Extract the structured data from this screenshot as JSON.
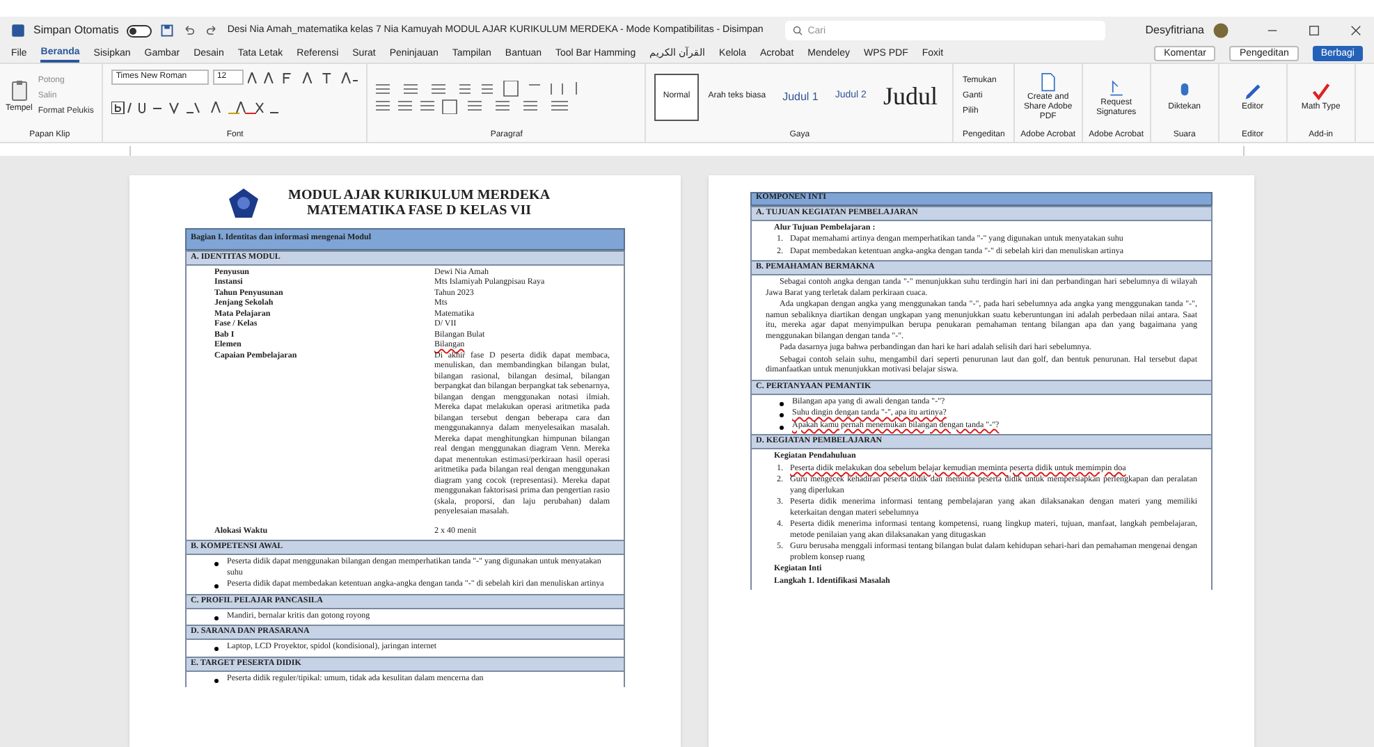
{
  "titlebar": {
    "autosave_label": "Simpan Otomatis",
    "autosave_on": false,
    "filename": "Desi Nia Amah_matematika kelas 7 Nia Kamuyah MODUL AJAR KURIKULUM MERDEKA - Mode Kompatibilitas - Disimpan",
    "search_placeholder": "Cari",
    "user": "Desyfitriana"
  },
  "menu_tabs": [
    {
      "label": "File",
      "selected": false
    },
    {
      "label": "Beranda",
      "selected": true
    },
    {
      "label": "Sisipkan",
      "selected": false
    },
    {
      "label": "Gambar",
      "selected": false
    },
    {
      "label": "Desain",
      "selected": false
    },
    {
      "label": "Tata Letak",
      "selected": false
    },
    {
      "label": "Referensi",
      "selected": false
    },
    {
      "label": "Surat",
      "selected": false
    },
    {
      "label": "Peninjauan",
      "selected": false
    },
    {
      "label": "Tampilan",
      "selected": false
    },
    {
      "label": "Bantuan",
      "selected": false
    },
    {
      "label": "Tool Bar Hamming",
      "selected": false
    },
    {
      "label": "القرآن الكريم",
      "selected": false
    },
    {
      "label": "Kelola",
      "selected": false
    },
    {
      "label": "Acrobat",
      "selected": false
    },
    {
      "label": "Mendeley",
      "selected": false
    },
    {
      "label": "WPS PDF",
      "selected": false
    },
    {
      "label": "Foxit",
      "selected": false
    }
  ],
  "action_buttons": [
    {
      "label": "Komentar",
      "kind": "plain"
    },
    {
      "label": "Pengeditan",
      "kind": "plain"
    },
    {
      "label": "Berbagi",
      "kind": "primary"
    }
  ],
  "clipboard": {
    "paste": "Tempel",
    "cut": "Potong",
    "copy": "Salin",
    "painter": "Format Pelukis",
    "label": "Papan Klip"
  },
  "font": {
    "name": "Times New Roman",
    "size": "12",
    "label": "Font"
  },
  "paragraph": {
    "label": "Paragraf"
  },
  "styles": {
    "label": "Gaya",
    "items": [
      {
        "label": "Normal",
        "kind": "normal",
        "selected": true
      },
      {
        "label": "Arah teks biasa",
        "kind": "normal",
        "selected": false
      },
      {
        "label": "Judul 1",
        "kind": "heading1",
        "selected": false
      },
      {
        "label": "Judul 2",
        "kind": "heading2",
        "selected": false
      },
      {
        "label": "Judul",
        "kind": "title",
        "selected": false
      }
    ]
  },
  "editing": {
    "label": "Pengeditan",
    "items": [
      "Temukan",
      "Ganti",
      "Pilih"
    ]
  },
  "addins": [
    {
      "label": "Create and Share Adobe PDF",
      "group": "Adobe Acrobat",
      "kind": "pdf"
    },
    {
      "label": "Request Signatures",
      "group": "Adobe Acrobat",
      "kind": "sign"
    },
    {
      "label": "Diktekan",
      "group": "Suara",
      "kind": "mic"
    },
    {
      "label": "Editor",
      "group": "Editor",
      "kind": "pen"
    },
    {
      "label": "Math Type",
      "group": "Add-in",
      "kind": "check"
    }
  ],
  "page_left": {
    "title_lines": [
      "MODUL AJAR KURIKULUM MERDEKA",
      "MATEMATIKA FASE D KELAS VII"
    ],
    "banner": "Bagian I. Identitas dan informasi mengenai Modul",
    "sections": [
      {
        "heading": "A. IDENTITAS MODUL",
        "blocks": [
          {
            "kind": "fields",
            "rows": [
              {
                "label": "Penyusun",
                "value": "Dewi Nia Amah",
                "flagged": false
              },
              {
                "label": "Instansi",
                "value": "Mts Islamiyah Pulangpisau Raya",
                "flagged": false
              },
              {
                "label": "Tahun Penyusunan",
                "value": "Tahun 2023",
                "flagged": false
              },
              {
                "label": "Jenjang Sekolah",
                "value": "Mts",
                "flagged": false
              },
              {
                "label": "Mata Pelajaran",
                "value": "Matematika",
                "flagged": false
              },
              {
                "label": "Fase / Kelas",
                "value": "D/ VII",
                "flagged": false
              },
              {
                "label": "Bab I",
                "value": "Bilangan Bulat",
                "flagged": false
              },
              {
                "label": "Elemen",
                "value": "Bilangan",
                "flagged": true
              },
              {
                "label": "Capaian Pembelajaran",
                "value": "Di akhir fase D peserta didik dapat membaca, menuliskan, dan membandingkan bilangan bulat, bilangan rasional, bilangan desimal, bilangan berpangkat dan bilangan berpangkat tak sebenarnya, bilangan dengan menggunakan notasi ilmiah. Mereka dapat melakukan operasi aritmetika pada bilangan tersebut dengan beberapa cara dan menggunakannya dalam menyelesaikan masalah. Mereka dapat menghitungkan himpunan bilangan real dengan menggunakan diagram Venn. Mereka dapat menentukan estimasi/perkiraan hasil operasi aritmetika pada bilangan real dengan menggunakan diagram yang cocok (representasi). Mereka dapat menggunakan faktorisasi prima dan pengertian rasio (skala, proporsi, dan laju perubahan) dalam penyelesaian masalah.",
                "flagged": false
              },
              {
                "label": "Alokasi Waktu",
                "value": "2 x 40 menit",
                "flagged": false
              }
            ]
          }
        ]
      },
      {
        "heading": "B. KOMPETENSI AWAL",
        "blocks": [
          {
            "kind": "bullets",
            "items": [
              {
                "text": "Peserta didik dapat menggunakan bilangan dengan memperhatikan tanda \"-\" yang digunakan untuk menyatakan suhu",
                "flagged": false
              },
              {
                "text": "Peserta didik dapat membedakan ketentuan angka-angka dengan tanda \"-\" di sebelah kiri dan menuliskan artinya",
                "flagged": false
              }
            ]
          }
        ]
      },
      {
        "heading": "C. PROFIL PELAJAR PANCASILA",
        "blocks": [
          {
            "kind": "bullets",
            "items": [
              {
                "text": "Mandiri, bernalar kritis dan gotong royong",
                "flagged": false
              }
            ]
          }
        ]
      },
      {
        "heading": "D. SARANA DAN PRASARANA",
        "blocks": [
          {
            "kind": "bullets",
            "items": [
              {
                "text": "Laptop, LCD Proyektor, spidol (kondisional), jaringan internet",
                "flagged": false
              }
            ]
          }
        ]
      },
      {
        "heading": "E. TARGET PESERTA DIDIK",
        "blocks": [
          {
            "kind": "bullets",
            "items": [
              {
                "text": "Peserta didik reguler/tipikal: umum, tidak ada kesulitan dalam mencerna dan",
                "flagged": false
              }
            ]
          }
        ]
      }
    ]
  },
  "page_right": {
    "banner": "KOMPONEN INTI",
    "sections": [
      {
        "heading": "A. TUJUAN KEGIATAN PEMBELAJARAN",
        "blocks": [
          {
            "kind": "subheading",
            "text": "Alur Tujuan Pembelajaran :"
          },
          {
            "kind": "numbered",
            "items": [
              {
                "number": "1.",
                "text": "Dapat memahami artinya dengan memperhatikan tanda \"-\" yang digunakan untuk menyatakan suhu",
                "flagged": false
              },
              {
                "number": "2.",
                "text": "Dapat membedakan ketentuan angka-angka dengan tanda \"-\" di sebelah kiri dan menuliskan artinya",
                "flagged": false
              }
            ]
          }
        ]
      },
      {
        "heading": "B. PEMAHAMAN BERMAKNA",
        "blocks": [
          {
            "kind": "paragraph",
            "text": "Sebagai contoh angka dengan tanda \"-\" menunjukkan suhu terdingin hari ini dan perbandingan hari sebelumnya di wilayah Jawa Barat yang terletak dalam perkiraan cuaca."
          },
          {
            "kind": "paragraph",
            "text": "Ada ungkapan dengan angka yang menggunakan tanda \"-\", pada hari sebelumnya ada angka yang menggunakan tanda \"-\", namun sebaliknya diartikan dengan ungkapan yang menunjukkan suatu keberuntungan ini adalah perbedaan nilai antara. Saat itu, mereka agar dapat menyimpulkan berupa penukaran pemahaman tentang bilangan apa dan yang bagaimana yang menggunakan bilangan dengan tanda \"-\"."
          },
          {
            "kind": "paragraph",
            "text": "Pada dasarnya juga bahwa perbandingan dan hari ke hari adalah selisih dari hari sebelumnya."
          },
          {
            "kind": "paragraph",
            "text": "Sebagai contoh selain suhu, mengambil dari seperti penurunan laut dan golf, dan bentuk penurunan. Hal tersebut dapat dimanfaatkan untuk menunjukkan motivasi belajar siswa."
          }
        ]
      },
      {
        "heading": "C. PERTANYAAN PEMANTIK",
        "blocks": [
          {
            "kind": "bullets",
            "items": [
              {
                "text": "Bilangan apa yang di awali dengan tanda \"-\"?",
                "flagged": false
              },
              {
                "text": "Suhu dingin dengan tanda \"-\", apa itu artinya?",
                "flagged": true
              },
              {
                "text": "Apakah kamu pernah menemukan bilangan dengan tanda \"-\"?",
                "flagged": true
              }
            ]
          }
        ]
      },
      {
        "heading": "D. KEGIATAN PEMBELAJARAN",
        "blocks": [
          {
            "kind": "subheading",
            "text": "Kegiatan Pendahuluan"
          },
          {
            "kind": "numbered",
            "items": [
              {
                "number": "1.",
                "text": "Peserta didik melakukan doa sebelum belajar kemudian meminta peserta didik untuk memimpin doa",
                "flagged": true
              },
              {
                "number": "2.",
                "text": "Guru mengecek kehadiran peserta didik dan meminta peserta didik untuk mempersiapkan perlengkapan dan peralatan yang diperlukan",
                "flagged": false
              },
              {
                "number": "3.",
                "text": "Peserta didik menerima informasi tentang pembelajaran yang akan dilaksanakan dengan materi yang memiliki keterkaitan dengan materi sebelumnya",
                "flagged": false
              },
              {
                "number": "4.",
                "text": "Peserta didik menerima informasi tentang kompetensi, ruang lingkup materi, tujuan, manfaat, langkah pembelajaran, metode penilaian yang akan dilaksanakan yang ditugaskan",
                "flagged": false
              },
              {
                "number": "5.",
                "text": "Guru berusaha menggali informasi tentang bilangan bulat dalam kehidupan sehari-hari dan pemahaman mengenai dengan problem konsep ruang",
                "flagged": false
              }
            ]
          },
          {
            "kind": "subheading",
            "text": "Kegiatan Inti"
          },
          {
            "kind": "subheading",
            "text": "Langkah 1. Identifikasi Masalah"
          }
        ]
      }
    ]
  }
}
